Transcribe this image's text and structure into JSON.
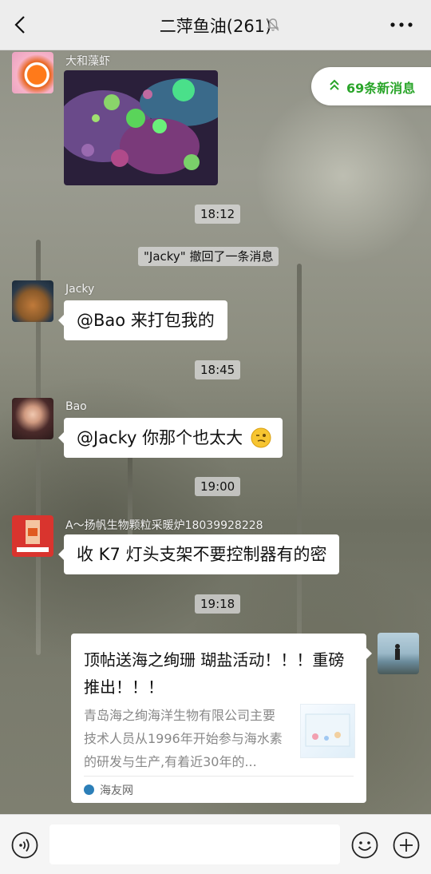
{
  "header": {
    "title": "二萍鱼油(261)"
  },
  "new_messages": {
    "label": "69条新消息"
  },
  "messages": [
    {
      "sender": "大和藻虾",
      "type": "image"
    },
    {
      "type": "time",
      "text": "18:12"
    },
    {
      "type": "system",
      "text": "\"Jacky\" 撤回了一条消息"
    },
    {
      "sender": "Jacky",
      "text": "@Bao  来打包我的"
    },
    {
      "type": "time",
      "text": "18:45"
    },
    {
      "sender": "Bao",
      "text": "@Jacky  你那个也太大"
    },
    {
      "type": "time",
      "text": "19:00"
    },
    {
      "sender": "A～扬帆生物颗粒采暖炉18039928228",
      "text": "收 K7 灯头支架不要控制器有的密"
    },
    {
      "type": "time",
      "text": "19:18"
    }
  ],
  "link_card": {
    "title": "顶帖送海之绚珊 瑚盐活动！！！重磅推出！！！",
    "description": "青岛海之绚海洋生物有限公司主要技术人员从1996年开始参与海水素的研发与生产,有着近30年的...",
    "source": "海友网"
  },
  "colors": {
    "accent_green": "#2aa52a",
    "topbar": "#ededed",
    "bubble": "#ffffff"
  }
}
